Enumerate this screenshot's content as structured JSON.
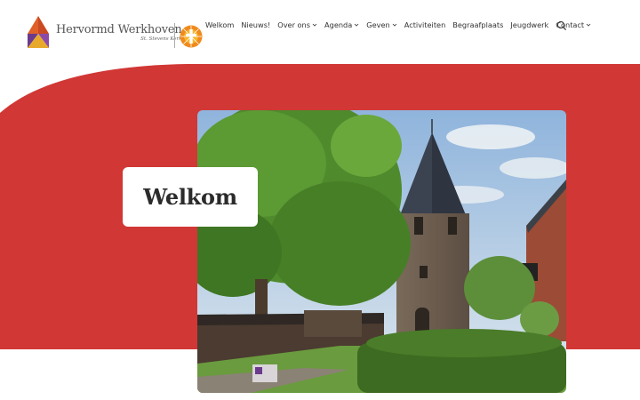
{
  "brand": {
    "name": "Hervormd Werkhoven",
    "subtitle": "St. Stevens Kerk",
    "partner_vertical_text": "Protestantse Kerk",
    "logo_icon": "church-roof-logo",
    "partner_icon": "sun-cross-logo"
  },
  "nav": {
    "items": [
      {
        "label": "Welkom",
        "dropdown": false
      },
      {
        "label": "Nieuws!",
        "dropdown": false
      },
      {
        "label": "Over ons",
        "dropdown": true
      },
      {
        "label": "Agenda",
        "dropdown": true
      },
      {
        "label": "Geven",
        "dropdown": true
      },
      {
        "label": "Activiteiten",
        "dropdown": false
      },
      {
        "label": "Begraafplaats",
        "dropdown": false
      },
      {
        "label": "Jeugdwerk",
        "dropdown": false
      },
      {
        "label": "Contact",
        "dropdown": true
      }
    ],
    "search_icon": "search-icon"
  },
  "hero": {
    "title": "Welkom",
    "image_subject": "church-tower-photo"
  },
  "colors": {
    "accent_red": "#d13735",
    "logo_orange": "#e0602a",
    "logo_purple": "#6b3a8c",
    "logo_gold": "#e8a92b"
  }
}
